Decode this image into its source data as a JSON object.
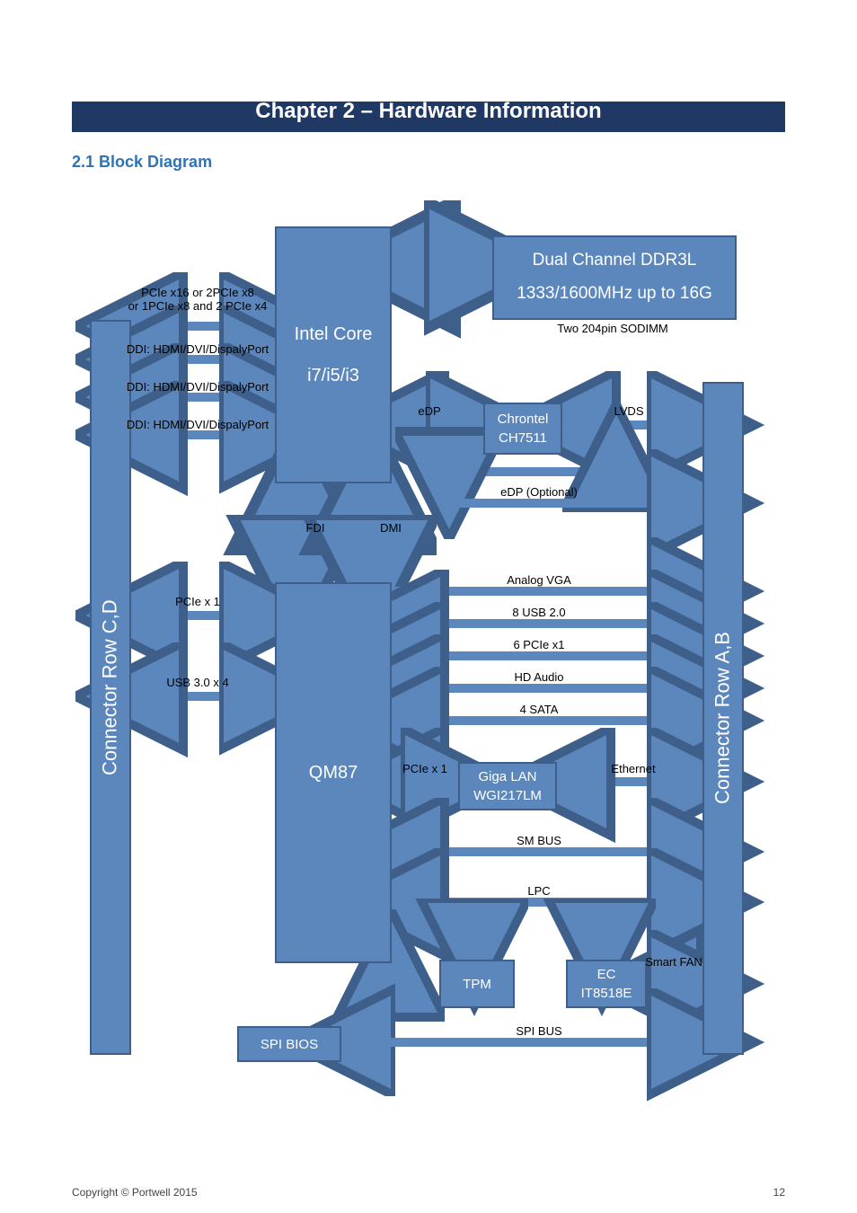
{
  "page": {
    "chapter": "Chapter 2 – Hardware Information",
    "section": "2.1 Block Diagram",
    "footer_left": "Copyright © Portwell 2015",
    "footer_right": "12"
  },
  "boxes": {
    "conn_cd": "Connector Row C,D",
    "conn_ab": "Connector Row A,B",
    "cpu_l1": "Intel Core",
    "cpu_l2": "i7/i5/i3",
    "pch": "QM87",
    "mem_l1": "Dual Channel DDR3L",
    "mem_l2": "1333/1600MHz up to 16G",
    "chrontel_l1": "Chrontel",
    "chrontel_l2": "CH7511",
    "lan_l1": "Giga LAN",
    "lan_l2": "WGI217LM",
    "tpm": "TPM",
    "ec_l1": "EC",
    "ec_l2": "IT8518E",
    "spi_bios": "SPI BIOS"
  },
  "labels": {
    "pcie_modes_l1": "PCIe x16 or 2PCIe x8",
    "pcie_modes_l2": "or 1PCIe x8 and 2 PCIe x4",
    "ddi1": "DDI: HDMI/DVI/DispalyPort",
    "ddi2": "DDI: HDMI/DVI/DispalyPort",
    "ddi3": "DDI: HDMI/DVI/DispalyPort",
    "sodimm": "Two 204pin SODIMM",
    "edp": "eDP",
    "lvds": "LVDS",
    "edp_opt": "eDP (Optional)",
    "fdi": "FDI",
    "dmi": "DMI",
    "pcie_x1_left": "PCIe x 1",
    "usb3": "USB 3.0 x 4",
    "analog_vga": "Analog VGA",
    "usb2": "8 USB 2.0",
    "pcie6": "6 PCIe x1",
    "hdaudio": "HD Audio",
    "sata": "4 SATA",
    "pcie_x1_right": "PCIe x 1",
    "ethernet": "Ethernet",
    "smbus": "SM BUS",
    "lpc": "LPC",
    "smart_fan": "Smart FAN",
    "spi_bus": "SPI BUS"
  },
  "chart_data": {
    "type": "block-diagram",
    "title": "2.1 Block Diagram",
    "nodes": [
      {
        "id": "CPU",
        "label": "Intel Core i7/i5/i3"
      },
      {
        "id": "PCH",
        "label": "QM87"
      },
      {
        "id": "MEM",
        "label": "Dual Channel DDR3L 1333/1600MHz up to 16G (Two 204pin SODIMM)"
      },
      {
        "id": "CH7511",
        "label": "Chrontel CH7511"
      },
      {
        "id": "LAN",
        "label": "Giga LAN WGI217LM"
      },
      {
        "id": "TPM",
        "label": "TPM"
      },
      {
        "id": "EC",
        "label": "EC IT8518E"
      },
      {
        "id": "SPI_BIOS",
        "label": "SPI BIOS"
      },
      {
        "id": "CONN_CD",
        "label": "Connector Row C,D"
      },
      {
        "id": "CONN_AB",
        "label": "Connector Row A,B"
      }
    ],
    "edges": [
      {
        "from": "CPU",
        "to": "MEM",
        "label": "DDR3L",
        "bidir": true
      },
      {
        "from": "CPU",
        "to": "CONN_CD",
        "label": "PCIe x16 / 2x8 / 1x8+2x4",
        "bidir": true
      },
      {
        "from": "CPU",
        "to": "CONN_CD",
        "label": "DDI: HDMI/DVI/DisplayPort",
        "bidir": true,
        "count": 3
      },
      {
        "from": "CPU",
        "to": "CH7511",
        "label": "eDP",
        "bidir": true
      },
      {
        "from": "CH7511",
        "to": "CONN_AB",
        "label": "LVDS",
        "bidir": true
      },
      {
        "from": "CPU",
        "to": "CONN_AB",
        "label": "eDP (Optional)",
        "bidir": true
      },
      {
        "from": "CPU",
        "to": "PCH",
        "label": "FDI",
        "bidir": true
      },
      {
        "from": "CPU",
        "to": "PCH",
        "label": "DMI",
        "bidir": true
      },
      {
        "from": "PCH",
        "to": "CONN_CD",
        "label": "PCIe x1",
        "bidir": true
      },
      {
        "from": "PCH",
        "to": "CONN_CD",
        "label": "USB 3.0 x4",
        "bidir": true
      },
      {
        "from": "PCH",
        "to": "CONN_AB",
        "label": "Analog VGA",
        "bidir": false
      },
      {
        "from": "PCH",
        "to": "CONN_AB",
        "label": "8 USB 2.0",
        "bidir": true
      },
      {
        "from": "PCH",
        "to": "CONN_AB",
        "label": "6 PCIe x1",
        "bidir": true
      },
      {
        "from": "PCH",
        "to": "CONN_AB",
        "label": "HD Audio",
        "bidir": true
      },
      {
        "from": "PCH",
        "to": "CONN_AB",
        "label": "4 SATA",
        "bidir": true
      },
      {
        "from": "PCH",
        "to": "LAN",
        "label": "PCIe x1",
        "bidir": true
      },
      {
        "from": "LAN",
        "to": "CONN_AB",
        "label": "Ethernet",
        "bidir": true
      },
      {
        "from": "PCH",
        "to": "CONN_AB",
        "label": "SM BUS",
        "bidir": true
      },
      {
        "from": "PCH",
        "to": "CONN_AB",
        "label": "LPC",
        "bidir": true
      },
      {
        "from": "PCH",
        "to": "TPM",
        "label": "LPC",
        "bidir": true
      },
      {
        "from": "PCH",
        "to": "EC",
        "label": "LPC",
        "bidir": true
      },
      {
        "from": "EC",
        "to": "CONN_AB",
        "label": "Smart FAN",
        "bidir": true
      },
      {
        "from": "PCH",
        "to": "SPI_BIOS",
        "label": "SPI",
        "bidir": true
      },
      {
        "from": "PCH",
        "to": "CONN_AB",
        "label": "SPI BUS",
        "bidir": true
      }
    ]
  }
}
